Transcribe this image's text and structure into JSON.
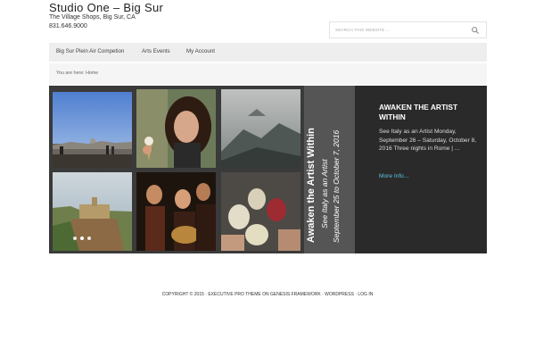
{
  "header": {
    "site_title": "Studio One  –  Big Sur",
    "description": "The Village Shops, Big Sur, CA",
    "phone": "831.646.9000"
  },
  "search": {
    "placeholder": "SEARCH THIS WEBSITE ..."
  },
  "nav": {
    "items": [
      {
        "label": "Big Sur Plein Air Competion"
      },
      {
        "label": "Arts Events"
      },
      {
        "label": "My Account"
      }
    ]
  },
  "breadcrumb": {
    "text": "You are here: Home"
  },
  "slider": {
    "vertical_text": {
      "line1": "Awaken the Artist Within",
      "line2": "See Italy as an Artist",
      "line3": "September 25 to October 7, 2016"
    },
    "caption": {
      "title": "AWAKEN THE ARTIST WITHIN",
      "text": "See Italy as an Artist Monday, September 26 – Saturday, October 8, 2016 Three nights in Rome | ...",
      "more_label": "More Info..."
    },
    "active_slide": 1
  },
  "footer": {
    "copyright": "Copyright © 2015",
    "theme": "Executive Pro Theme",
    "on": "on",
    "framework": "Genesis Framework",
    "wordpress": "WordPress",
    "login": "Log in",
    "sep": "·"
  },
  "colors": {
    "link_accent": "#5bc5e0",
    "caption_bg": "#2a2a2a",
    "nav_bg": "#eeeeee"
  }
}
